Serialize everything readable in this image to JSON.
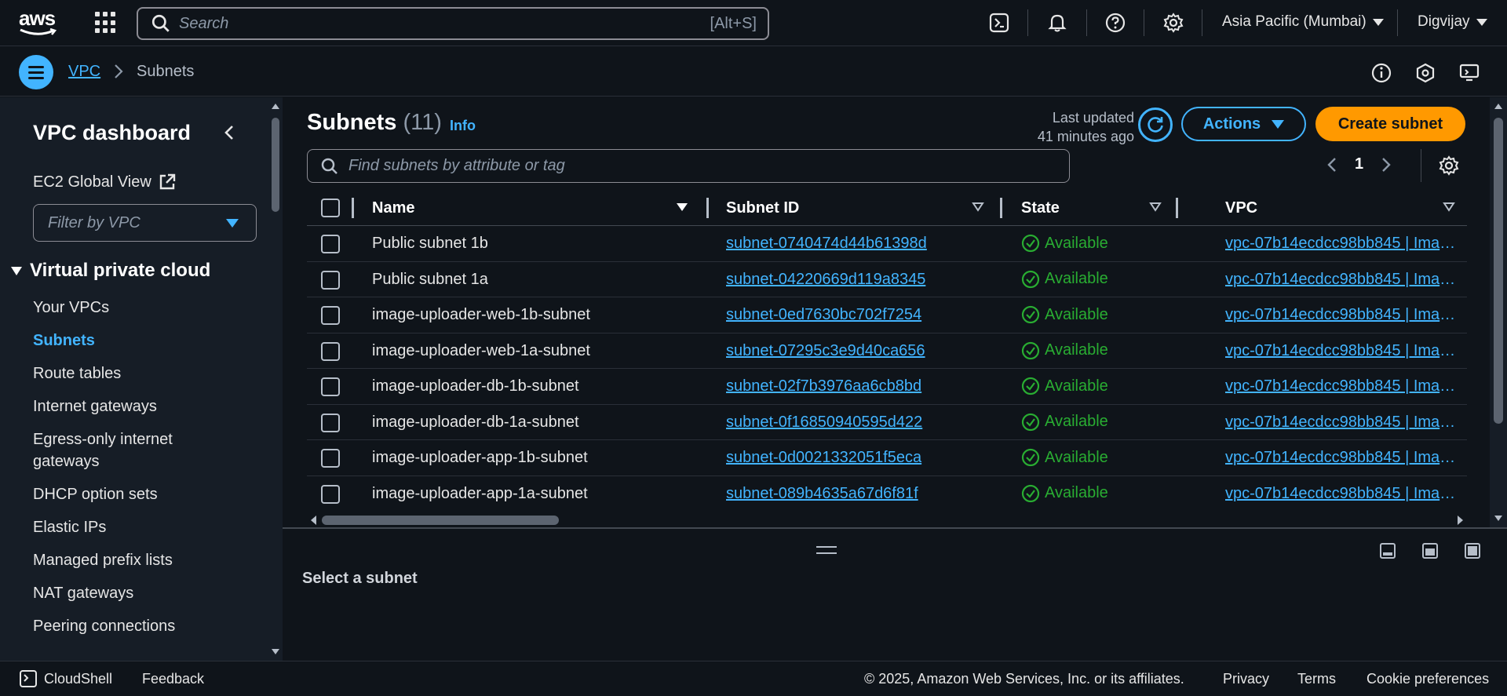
{
  "topnav": {
    "logo_text": "aws",
    "search_placeholder": "Search",
    "search_shortcut": "[Alt+S]",
    "region": "Asia Pacific (Mumbai)",
    "user": "Digvijay"
  },
  "breadcrumb": {
    "root": "VPC",
    "current": "Subnets"
  },
  "sidebar": {
    "title": "VPC dashboard",
    "ec2_global_view": "EC2 Global View",
    "filter_placeholder": "Filter by VPC",
    "section": "Virtual private cloud",
    "items": [
      {
        "label": "Your VPCs",
        "active": false
      },
      {
        "label": "Subnets",
        "active": true
      },
      {
        "label": "Route tables",
        "active": false
      },
      {
        "label": "Internet gateways",
        "active": false
      },
      {
        "label": "Egress-only internet gateways",
        "active": false
      },
      {
        "label": "DHCP option sets",
        "active": false
      },
      {
        "label": "Elastic IPs",
        "active": false
      },
      {
        "label": "Managed prefix lists",
        "active": false
      },
      {
        "label": "NAT gateways",
        "active": false
      },
      {
        "label": "Peering connections",
        "active": false
      }
    ]
  },
  "main": {
    "title": "Subnets",
    "count": "(11)",
    "info": "Info",
    "last_updated_label": "Last updated",
    "last_updated_value": "41 minutes ago",
    "actions_label": "Actions",
    "create_label": "Create subnet",
    "filter_placeholder": "Find subnets by attribute or tag",
    "page": "1",
    "columns": {
      "name": "Name",
      "subnet_id": "Subnet ID",
      "state": "State",
      "vpc": "VPC"
    },
    "rows": [
      {
        "name": "Public subnet 1b",
        "subnet_id": "subnet-0740474d44b61398d",
        "state": "Available",
        "vpc": "vpc-07b14ecdcc98bb845 | Imag..."
      },
      {
        "name": "Public subnet 1a",
        "subnet_id": "subnet-04220669d119a8345",
        "state": "Available",
        "vpc": "vpc-07b14ecdcc98bb845 | Imag..."
      },
      {
        "name": "image-uploader-web-1b-subnet",
        "subnet_id": "subnet-0ed7630bc702f7254",
        "state": "Available",
        "vpc": "vpc-07b14ecdcc98bb845 | Imag..."
      },
      {
        "name": "image-uploader-web-1a-subnet",
        "subnet_id": "subnet-07295c3e9d40ca656",
        "state": "Available",
        "vpc": "vpc-07b14ecdcc98bb845 | Imag..."
      },
      {
        "name": "image-uploader-db-1b-subnet",
        "subnet_id": "subnet-02f7b3976aa6cb8bd",
        "state": "Available",
        "vpc": "vpc-07b14ecdcc98bb845 | Imag..."
      },
      {
        "name": "image-uploader-db-1a-subnet",
        "subnet_id": "subnet-0f16850940595d422",
        "state": "Available",
        "vpc": "vpc-07b14ecdcc98bb845 | Imag..."
      },
      {
        "name": "image-uploader-app-1b-subnet",
        "subnet_id": "subnet-0d0021332051f5eca",
        "state": "Available",
        "vpc": "vpc-07b14ecdcc98bb845 | Imag..."
      },
      {
        "name": "image-uploader-app-1a-subnet",
        "subnet_id": "subnet-089b4635a67d6f81f",
        "state": "Available",
        "vpc": "vpc-07b14ecdcc98bb845 | Imag..."
      }
    ]
  },
  "split_panel": {
    "label": "Select a subnet"
  },
  "footer": {
    "cloudshell": "CloudShell",
    "feedback": "Feedback",
    "copyright": "© 2025, Amazon Web Services, Inc. or its affiliates.",
    "privacy": "Privacy",
    "terms": "Terms",
    "cookie": "Cookie preferences"
  },
  "colors": {
    "accent": "#42b4ff",
    "primary_button": "#ff9900",
    "available": "#29ad32",
    "background": "#0f141a",
    "sidebar": "#161d26"
  }
}
